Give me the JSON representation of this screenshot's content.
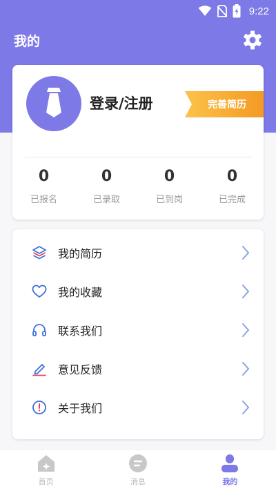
{
  "status_bar": {
    "time": "9:22",
    "icons": [
      "wifi-icon",
      "no-sim-icon",
      "battery-charging-icon"
    ]
  },
  "header": {
    "title": "我的",
    "settings_icon": "gear-icon"
  },
  "profile": {
    "avatar_icon": "tie-icon",
    "login_label": "登录/注册",
    "resume_badge": "完善简历",
    "stats": [
      {
        "value": "0",
        "label": "已报名"
      },
      {
        "value": "0",
        "label": "已录取"
      },
      {
        "value": "0",
        "label": "已到岗"
      },
      {
        "value": "0",
        "label": "已完成"
      }
    ]
  },
  "menu": {
    "items": [
      {
        "label": "我的简历",
        "icon": "layers-icon"
      },
      {
        "label": "我的收藏",
        "icon": "heart-icon"
      },
      {
        "label": "联系我们",
        "icon": "headphones-icon"
      },
      {
        "label": "意见反馈",
        "icon": "pencil-icon"
      },
      {
        "label": "关于我们",
        "icon": "info-exclamation-icon"
      }
    ]
  },
  "tabs": [
    {
      "label": "首页",
      "icon": "home-icon",
      "active": false
    },
    {
      "label": "消息",
      "icon": "message-icon",
      "active": false
    },
    {
      "label": "我的",
      "icon": "user-icon",
      "active": true
    }
  ],
  "colors": {
    "accent": "#7d79e6",
    "badge": "#f49a24",
    "icon_blue": "#3b6fd8",
    "arrow": "#8aa4e0"
  }
}
